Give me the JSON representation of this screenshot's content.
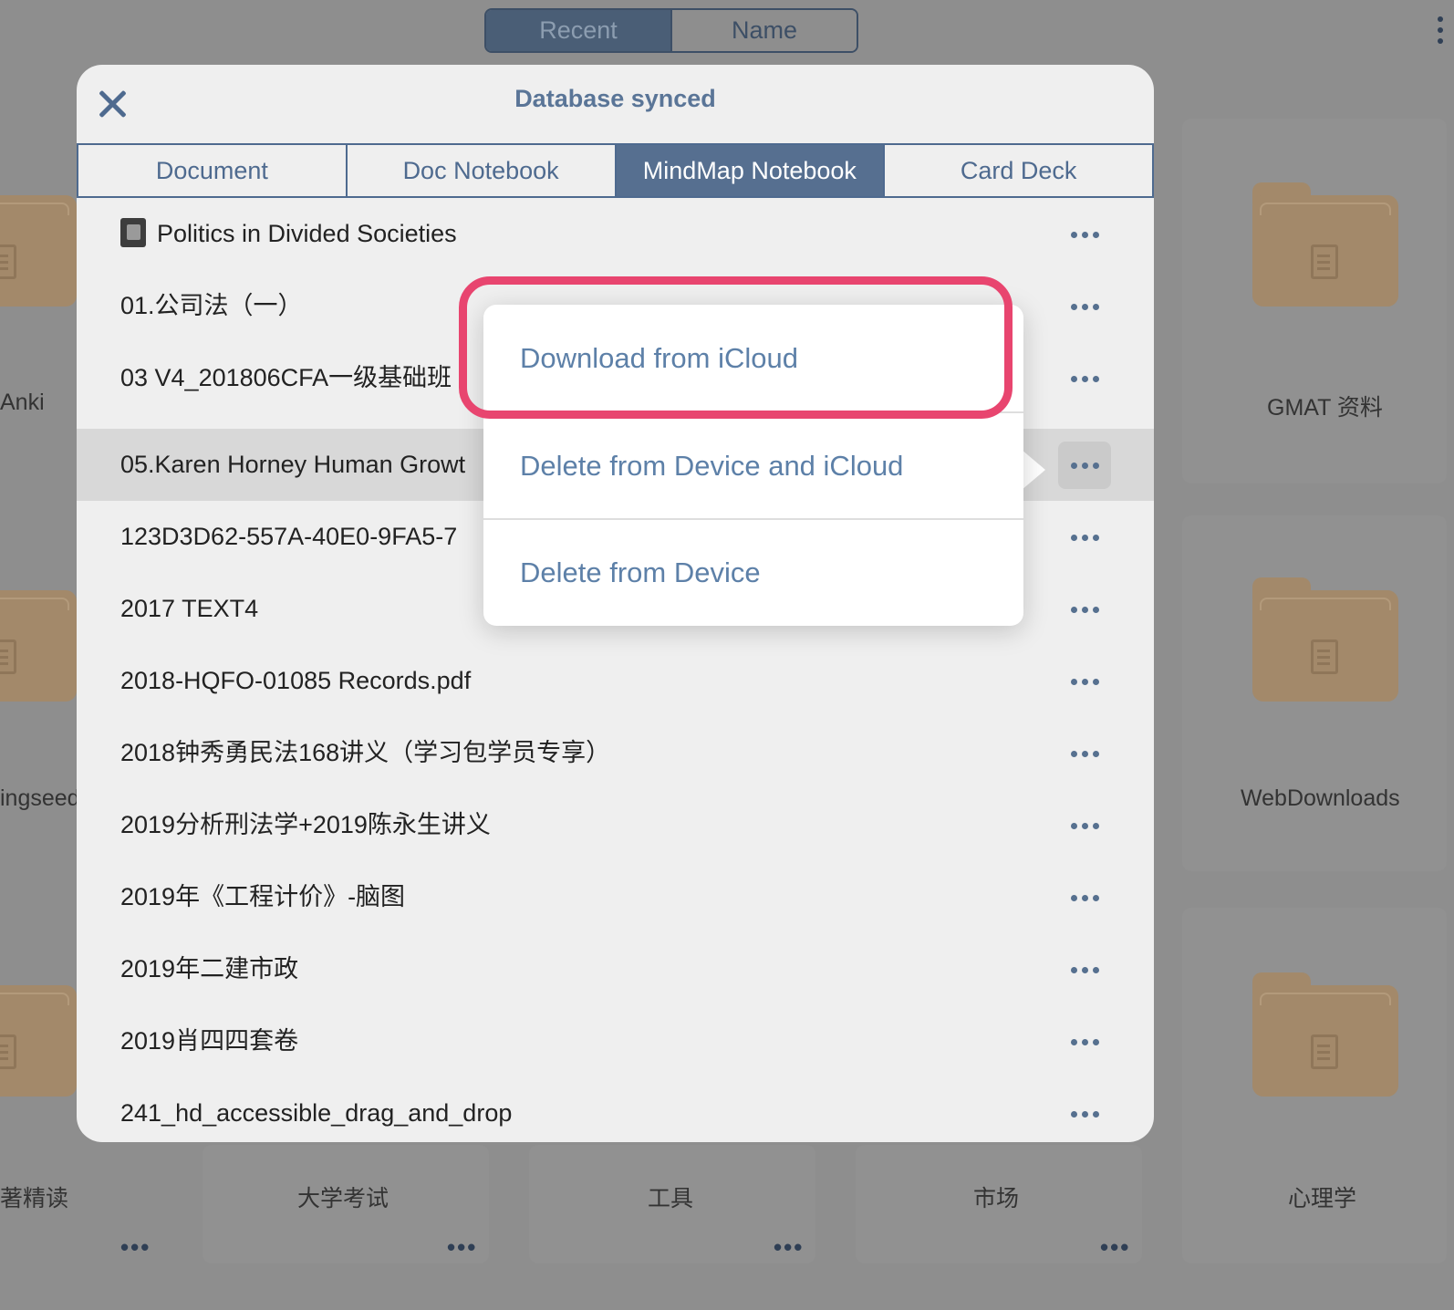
{
  "background": {
    "sort_segment": {
      "options": [
        "Recent",
        "Name"
      ],
      "selected": "Recent"
    },
    "folders": [
      {
        "label": "Anki"
      },
      {
        "label": "GMAT 资料"
      },
      {
        "label": "ingseed"
      },
      {
        "label": "WebDownloads"
      },
      {
        "label": "著精读"
      },
      {
        "label": "大学考试"
      },
      {
        "label": "工具"
      },
      {
        "label": "市场"
      },
      {
        "label": "心理学"
      }
    ],
    "more_glyph": "•••"
  },
  "modal": {
    "title": "Database synced",
    "close_icon": "close-icon",
    "tabs": [
      {
        "label": "Document",
        "active": false
      },
      {
        "label": "Doc Notebook",
        "active": false
      },
      {
        "label": "MindMap Notebook",
        "active": true
      },
      {
        "label": "Card Deck",
        "active": false
      }
    ],
    "items": [
      {
        "title": "Politics in Divided Societies",
        "icon": "notebook-icon"
      },
      {
        "title": "01.公司法（一）"
      },
      {
        "title": "03 V4_201806CFA一级基础班"
      },
      {
        "title": "05.Karen Horney Human Growt",
        "selected": true
      },
      {
        "title": "123D3D62-557A-40E0-9FA5-7"
      },
      {
        "title": "2017 TEXT4"
      },
      {
        "title": "2018-HQFO-01085 Records.pdf"
      },
      {
        "title": "2018钟秀勇民法168讲义（学习包学员专享）"
      },
      {
        "title": "2019分析刑法学+2019陈永生讲义"
      },
      {
        "title": "2019年《工程计价》-脑图"
      },
      {
        "title": "2019年二建市政"
      },
      {
        "title": "2019肖四四套卷"
      },
      {
        "title": "241_hd_accessible_drag_and_drop"
      }
    ]
  },
  "popover": {
    "items": [
      {
        "label": "Download from iCloud",
        "highlighted": true
      },
      {
        "label": "Delete from Device and iCloud"
      },
      {
        "label": "Delete from Device"
      }
    ]
  },
  "colors": {
    "accent": "#4e6a8f",
    "highlight": "#e8456f",
    "folder": "#a3896a"
  }
}
